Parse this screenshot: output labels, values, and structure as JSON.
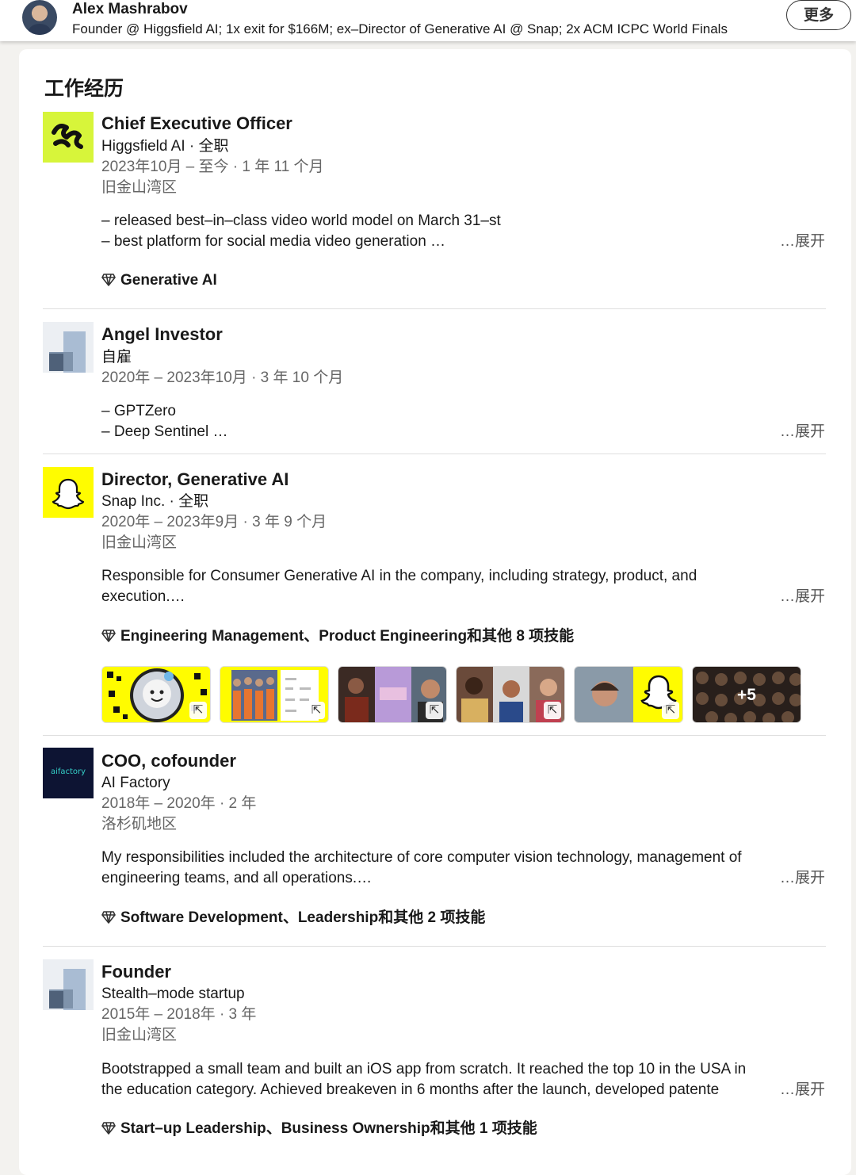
{
  "header": {
    "name": "Alex Mashrabov",
    "headline": "Founder @ Higgsfield AI; 1x exit for $166M; ex–Director of Generative AI @ Snap; 2x ACM ICPC World Finals",
    "more_label": "更多"
  },
  "section_title": "工作经历",
  "expand_label": "…展开",
  "media_more": "+5",
  "experience": [
    {
      "title": "Chief Executive Officer",
      "company": "Higgsfield AI · 全职",
      "dates": "2023年10月 – 至今 · 1 年 11 个月",
      "location": "旧金山湾区",
      "description": [
        "– released best–in–class video world model on March 31–st",
        "– best platform for social media video generation …"
      ],
      "skills": "Generative AI",
      "logo": "higgsfield-logo"
    },
    {
      "title": "Angel Investor",
      "company": "自雇",
      "dates": "2020年 – 2023年10月 · 3 年 10 个月",
      "description": [
        "– GPTZero",
        "– Deep Sentinel …"
      ],
      "logo": "placeholder-company-logo"
    },
    {
      "title": "Director, Generative AI",
      "company": "Snap Inc. · 全职",
      "dates": "2020年 – 2023年9月 · 3 年 9 个月",
      "location": "旧金山湾区",
      "description": [
        "Responsible for Consumer Generative AI in the company, including strategy, product, and",
        "execution.…"
      ],
      "skills": "Engineering Management、Product Engineering和其他 8 项技能",
      "logo": "snapchat-ghost-logo"
    },
    {
      "title": "COO, cofounder",
      "company": "AI Factory",
      "dates": "2018年 – 2020年 · 2 年",
      "location": "洛杉矶地区",
      "description": [
        "My responsibilities included the architecture of core computer vision technology, management of",
        "engineering teams, and all operations.…"
      ],
      "skills": "Software Development、Leadership和其他 2 项技能",
      "logo_text": "aifactory"
    },
    {
      "title": "Founder",
      "company": "Stealth–mode startup",
      "dates": "2015年 – 2018年 · 3 年",
      "location": "旧金山湾区",
      "description": [
        "Bootstrapped a small team and built an iOS app from scratch. It reached the top 10 in the USA in",
        "the education category. Achieved breakeven in 6 months after the launch, developed patente"
      ],
      "skills": "Start–up Leadership、Business Ownership和其他 1 项技能",
      "logo": "placeholder-company-logo"
    }
  ],
  "colors": {
    "higgsfield_green": "#d7f53a",
    "snap_yellow": "#fffc00",
    "aifactory_navy": "#0d1433",
    "aifactory_teal": "#35d0c8"
  }
}
